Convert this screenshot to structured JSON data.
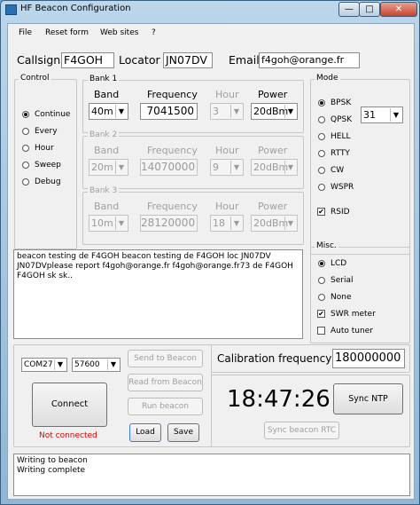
{
  "window": {
    "title": "HF Beacon Configuration",
    "min": "—",
    "max": "□",
    "close": "✕"
  },
  "menu": [
    "File",
    "Reset form",
    "Web sites",
    "?"
  ],
  "top": {
    "callsign_label": "Callsign",
    "callsign": "F4GOH",
    "locator_label": "Locator",
    "locator": "JN07DV",
    "email_label": "Email",
    "email": "f4goh@orange.fr"
  },
  "control": {
    "label": "Control",
    "options": [
      "Continue",
      "Every",
      "Hour",
      "Sweep",
      "Debug"
    ],
    "selected": 0
  },
  "banks": {
    "headers": {
      "band": "Band",
      "frequency": "Frequency",
      "hour": "Hour",
      "power": "Power"
    },
    "items": [
      {
        "label": "Bank 1",
        "band": "40m",
        "frequency": "7041500",
        "hour": "3",
        "power": "20dBm",
        "enabled": true
      },
      {
        "label": "Bank 2",
        "band": "20m",
        "frequency": "14070000",
        "hour": "9",
        "power": "20dBm",
        "enabled": false
      },
      {
        "label": "Bank 3",
        "band": "10m",
        "frequency": "28120000",
        "hour": "18",
        "power": "20dBm",
        "enabled": false
      }
    ]
  },
  "mode": {
    "label": "Mode",
    "options": [
      "BPSK",
      "QPSK",
      "HELL",
      "RTTY",
      "CW",
      "WSPR"
    ],
    "selected": 0,
    "qpsk_value": "31",
    "rsid_label": "RSID",
    "rsid": true
  },
  "message": "beacon testing de F4GOH beacon testing de F4GOH loc JN07DV JN07DVplease report f4goh@orange.fr f4goh@orange.fr73 de F4GOH F4GOH sk sk..",
  "misc": {
    "label": "Misc.",
    "options": [
      "LCD",
      "Serial",
      "None"
    ],
    "selected": 0,
    "swr_label": "SWR meter",
    "swr": true,
    "autotuner_label": "Auto tuner",
    "autotuner": false
  },
  "serial": {
    "port": "COM27",
    "baud": "57600",
    "connect": "Connect",
    "status": "Not connected",
    "status_color": "#e00000",
    "send": "Send to Beacon",
    "read": "Read from Beacon",
    "run": "Run beacon",
    "load": "Load",
    "save": "Save"
  },
  "calibration": {
    "label": "Calibration frequency",
    "value": "180000000"
  },
  "clock": {
    "time": "18:47:26",
    "sync_ntp": "Sync NTP",
    "sync_rtc": "Sync beacon RTC"
  },
  "log": [
    "Writing to beacon",
    "Writing complete"
  ]
}
